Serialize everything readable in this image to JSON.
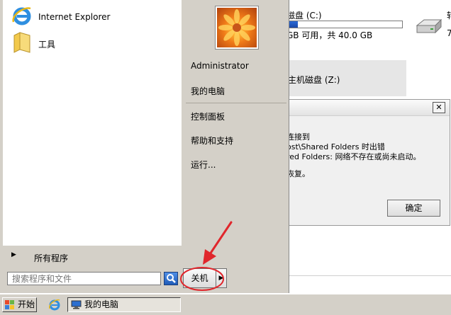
{
  "start_menu": {
    "pinned": [
      {
        "label": "Internet Explorer",
        "icon": "ie-icon"
      },
      {
        "label": "工具",
        "icon": "folder-icon"
      }
    ],
    "all_programs": "所有程序",
    "search_placeholder": "搜索程序和文件",
    "user_name": "Administrator",
    "right_items": [
      "我的电脑",
      "控制面板",
      "帮助和支持",
      "运行..."
    ],
    "shutdown_label": "关机"
  },
  "explorer": {
    "drive_c_title": "磁盘 (C:)",
    "drive_c_usage": "GB 可用，共 40.0 GB",
    "drive_c_used_fraction": 0.08,
    "drive_z_label": "主机磁盘 (Z:)",
    "edge_fragment_1": "转",
    "edge_fragment_2": "7"
  },
  "dialog": {
    "lines": [
      "连接到",
      "ost\\Shared Folders 时出错",
      "red Folders: 网络不存在或尚未启动。",
      "恢复。"
    ],
    "ok_label": "确定",
    "close_glyph": "✕"
  },
  "taskbar": {
    "start_label": "开始",
    "task_label": "我的电脑"
  },
  "colors": {
    "menu_bg": "#d4d0c8",
    "annotation_red": "#e0262c",
    "progress_blue": "#1b48a8"
  }
}
